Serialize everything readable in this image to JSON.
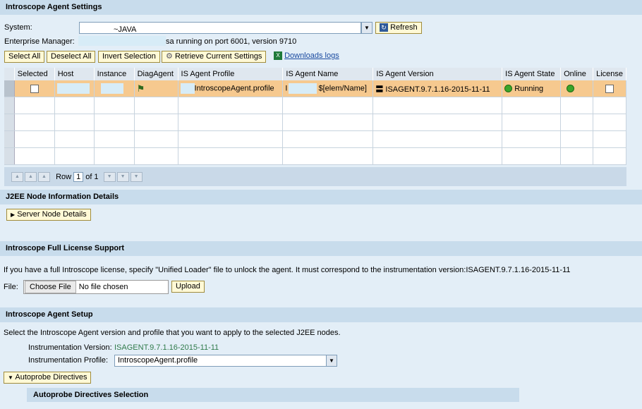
{
  "sections": {
    "agent_settings": "Introscope Agent Settings",
    "j2ee_details": "J2EE Node Information Details",
    "full_license": "Introscope Full License Support",
    "agent_setup": "Introscope Agent Setup",
    "autoprobe_selection": "Autoprobe Directives Selection"
  },
  "system": {
    "label": "System:",
    "value": "~JAVA",
    "refresh_label": "Refresh"
  },
  "enterprise_manager": {
    "label": "Enterprise Manager:",
    "status": "sa running on port 6001, version 9710"
  },
  "toolbar": {
    "select_all": "Select All",
    "deselect_all": "Deselect All",
    "invert_selection": "Invert Selection",
    "retrieve_settings": "Retrieve Current Settings",
    "download_logs": "Downloads logs"
  },
  "table": {
    "columns": [
      "Selected",
      "Host",
      "Instance",
      "DiagAgent",
      "IS Agent Profile",
      "IS Agent Name",
      "IS Agent Version",
      "IS Agent State",
      "Online",
      "License"
    ],
    "rows": [
      {
        "profile": "IntroscopeAgent.profile",
        "name_prefix": "I",
        "name": "$[elem/Name]",
        "version": "ISAGENT.9.7.1.16-2015-11-11",
        "state": "Running"
      }
    ],
    "pager": {
      "row_label": "Row",
      "row_value": "1",
      "of_label": "of 1"
    }
  },
  "server_node_details": "Server Node Details",
  "license": {
    "description": "If you have a full Introscope license, specify \"Unified Loader\" file to unlock the agent. It must correspond to the instrumentation version:ISAGENT.9.7.1.16-2015-11-11",
    "file_label": "File:",
    "choose_file": "Choose File",
    "no_file": "No file chosen",
    "upload": "Upload"
  },
  "setup": {
    "description": "Select the Introscope Agent version and profile that you want to apply to the selected J2EE nodes.",
    "version_label": "Instrumentation Version:",
    "version_value": "ISAGENT.9.7.1.16-2015-11-11",
    "profile_label": "Instrumentation Profile:",
    "profile_value": "IntroscopeAgent.profile",
    "autoprobe_label": "Autoprobe Directives"
  },
  "colors": {
    "selected_row": "#f6c98f",
    "header_bar": "#c8dcec",
    "button_bg": "#fff9d6",
    "version_text": "#2f7a4a"
  }
}
